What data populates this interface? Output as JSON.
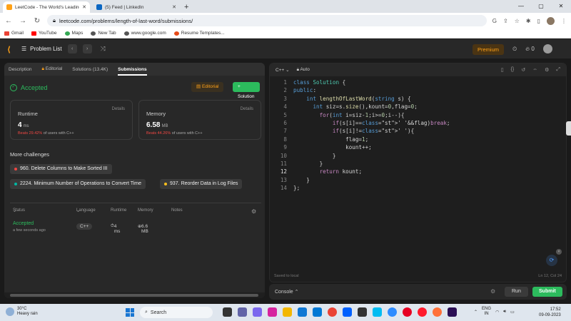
{
  "browser": {
    "tabs": [
      {
        "title": "LeetCode - The World's Leading",
        "active": true
      },
      {
        "title": "(5) Feed | LinkedIn",
        "active": false
      }
    ],
    "url": "leetcode.com/problems/length-of-last-word/submissions/",
    "bookmarks": [
      "Gmail",
      "YouTube",
      "Maps",
      "New Tab",
      "www.google.com",
      "Resume Templates..."
    ]
  },
  "lc_header": {
    "problem_list": "Problem List",
    "premium": "Premium",
    "coins": "0"
  },
  "left": {
    "tabs": [
      "Description",
      "Editorial",
      "Solutions (13.4K)",
      "Submissions"
    ],
    "status": "Accepted",
    "editorial_btn": "Editorial",
    "solution_btn": "Solution",
    "runtime": {
      "label": "Runtime",
      "details": "Details",
      "value": "4",
      "unit": "ms",
      "beats_pct": "Beats 29.42%",
      "beats_rest": "of users with C++"
    },
    "memory": {
      "label": "Memory",
      "details": "Details",
      "value": "6.58",
      "unit": "MB",
      "beats_pct": "Beats 44.26%",
      "beats_rest": "of users with C++"
    },
    "more_challenges": "More challenges",
    "challenges": [
      {
        "text": "960. Delete Columns to Make Sorted III",
        "color": "#ef4743"
      },
      {
        "text": "2224. Minimum Number of Operations to Convert Time",
        "color": "#00b8a3"
      },
      {
        "text": "937. Reorder Data in Log Files",
        "color": "#ffc01e"
      }
    ],
    "table_headers": {
      "status": "Status",
      "language": "Language",
      "runtime": "Runtime",
      "memory": "Memory",
      "notes": "Notes"
    },
    "row": {
      "status": "Accepted",
      "time": "a few seconds ago",
      "language": "C++",
      "runtime": "4 ms",
      "memory": "6.6 MB"
    }
  },
  "editor": {
    "language": "C++",
    "mode": "Auto",
    "code_lines": [
      "class Solution {",
      "public:",
      "    int lengthOfLastWord(string s) {",
      "      int siz=s.size(),kount=0,flag=0;",
      "        for(int i=siz-1;i>=0;i--){",
      "            if(s[i]==' '&&flag)break;",
      "            if(s[i]!=' '){",
      "                flag=1;",
      "                kount++;",
      "            }",
      "        }",
      "        return kount;",
      "    }",
      "};"
    ],
    "current_line": 12,
    "saved": "Saved to local",
    "cursor": "Ln 12, Col 24"
  },
  "console": {
    "label": "Console",
    "run": "Run",
    "submit": "Submit"
  },
  "taskbar": {
    "temp": "30°C",
    "weather": "Heavy rain",
    "search": "Search",
    "lang1": "ENG",
    "lang2": "IN",
    "time": "17:52",
    "date": "09-09-2023"
  }
}
